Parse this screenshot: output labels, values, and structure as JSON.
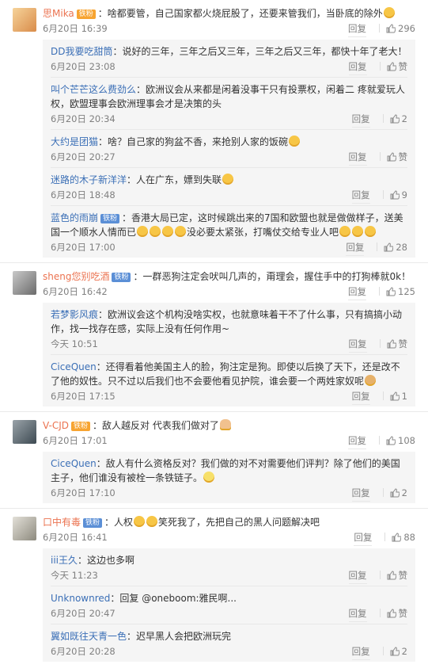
{
  "comments": [
    {
      "user": "思Mika",
      "badge": "铁粉",
      "text": "：啥都要管，自己国家都火烧屁股了，还要来管我们，当卧底的除外",
      "time": "6月20日 16:39",
      "reply_label": "回复",
      "likes": "296",
      "replies": [
        {
          "user": "DD我要吃甜筒",
          "text": "：说好的三年，三年之后又三年，三年之后又三年，都快十年了老大！",
          "time": "6月20日 23:08",
          "reply_label": "回复",
          "likes": "赞"
        },
        {
          "user": "叫个芒芒这么费劲么",
          "text": "：欧洲议会从来都是闲着没事干只有投票权，闲着二 疼就爱玩人权，欧盟理事会欧洲理事会才是决策的头",
          "time": "6月20日 20:34",
          "reply_label": "回复",
          "likes": "2"
        },
        {
          "user": "大约是团猫",
          "text": "：啥？自己家的狗盆不香，来抢别人家的饭碗",
          "time": "6月20日 20:27",
          "reply_label": "回复",
          "likes": "赞"
        },
        {
          "user": "迷路的木子新洋洋",
          "text": "：人在广东，嫖到失联",
          "time": "6月20日 18:48",
          "reply_label": "回复",
          "likes": "9"
        },
        {
          "user": "蓝色的雨崩",
          "badge": "铁粉",
          "text": "：香港大局已定，这时候跳出来的7国和欧盟也就是做做样子，送美国一个顺水人情而已",
          "text_tail": "没必要太紧张，打嘴仗交给专业人吧",
          "time": "6月20日 17:00",
          "reply_label": "回复",
          "likes": "28"
        }
      ]
    },
    {
      "user": "sheng您别吃酒",
      "badge": "铁粉",
      "text": "：一群恶狗注定会吠叫几声的，甭理会，握住手中的打狗棒就0k！",
      "time": "6月20日 16:42",
      "reply_label": "回复",
      "likes": "125",
      "replies": [
        {
          "user": "若梦影风痕",
          "text": "：欧洲议会这个机构没啥实权，也就意味着干不了什么事，只有搞搞小动作，找一找存在感，实际上没有任何作用~",
          "time": "今天 10:51",
          "reply_label": "回复",
          "likes": "赞"
        },
        {
          "user": "CiceQuen",
          "text": "：还得看着他美国主人的脸，狗注定是狗。即使以后换了天下，还是改不了他的奴性。只不过以后我们也不会要他看见护院，谁会要一个两姓家奴呢",
          "time": "6月20日 17:15",
          "reply_label": "回复",
          "likes": "1"
        }
      ]
    },
    {
      "user": "V-CJD",
      "badge": "铁粉",
      "text": "：敌人越反对 代表我们做对了",
      "time": "6月20日 17:01",
      "reply_label": "回复",
      "likes": "108",
      "replies": [
        {
          "user": "CiceQuen",
          "text": "：敌人有什么资格反对？我们做的对不对需要他们评判？除了他们的美国主子，他们谁没有被栓一条铁链子。",
          "time": "6月20日 17:10",
          "reply_label": "回复",
          "likes": "2"
        }
      ]
    },
    {
      "user": "口中有毒",
      "badge": "铁粉",
      "text": "：人权",
      "text_tail": "笑死我了，先把自己的黑人问题解决吧",
      "time": "6月20日 16:41",
      "reply_label": "回复",
      "likes": "88",
      "replies": [
        {
          "user": "iii王久",
          "text": "：这边也多啊",
          "time": "今天 11:23",
          "reply_label": "回复",
          "likes": "赞"
        },
        {
          "user": "Unknownred",
          "text": "：回复 @oneboom:雅民啊...",
          "time": "6月20日 20:47",
          "reply_label": "回复",
          "likes": "赞"
        },
        {
          "user": "翼如既往天青一色",
          "text": "：迟早黑人会把欧洲玩完",
          "time": "6月20日 20:28",
          "reply_label": "回复",
          "likes": "2"
        }
      ]
    }
  ],
  "icons": {
    "like": "thumbs-up-icon",
    "emoji": "emoji-icon"
  },
  "colors": {
    "username": "#eb7350",
    "reply_username": "#3b6fb6",
    "meta": "#808080",
    "reply_bg": "#f5f5f5"
  }
}
